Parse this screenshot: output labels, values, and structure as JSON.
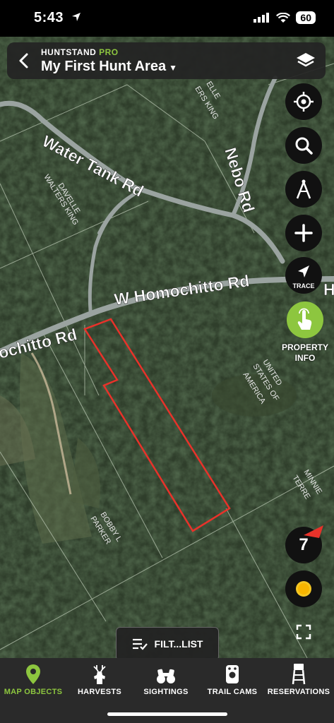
{
  "status_bar": {
    "time": "5:43",
    "battery": "60"
  },
  "header": {
    "brand": "HUNTSTAND",
    "brand_tier": "PRO",
    "area_name": "My First Hunt Area"
  },
  "map": {
    "road_labels": [
      "Water Tank Rd",
      "Nebo Rd",
      "W Homochitto Rd",
      "ochitto Rd",
      "H"
    ],
    "owner_labels": [
      "DAVELLE",
      "WALTERS KING",
      "ELLE",
      "ERS KING",
      "UNITED",
      "STATES OF",
      "AMERICA",
      "BOBBY L",
      "PARKER",
      "MINNIE",
      "TERRE"
    ],
    "wind_speed": "7"
  },
  "tools": {
    "trace_label": "TRACE",
    "property_info_label": "PROPERTY INFO"
  },
  "filter_button": {
    "label": "FILT...LIST"
  },
  "bottom_nav": [
    {
      "label": "MAP OBJECTS",
      "icon": "map-pin-icon",
      "active": true
    },
    {
      "label": "HARVESTS",
      "icon": "deer-icon",
      "active": false
    },
    {
      "label": "SIGHTINGS",
      "icon": "binoculars-icon",
      "active": false
    },
    {
      "label": "TRAIL CAMS",
      "icon": "trail-camera-icon",
      "active": false
    },
    {
      "label": "RESERVATIONS",
      "icon": "tree-stand-icon",
      "active": false
    }
  ],
  "colors": {
    "accent": "#8dc63f",
    "boundary": "#e8322a",
    "bar_bg": "#2a2a2a"
  }
}
